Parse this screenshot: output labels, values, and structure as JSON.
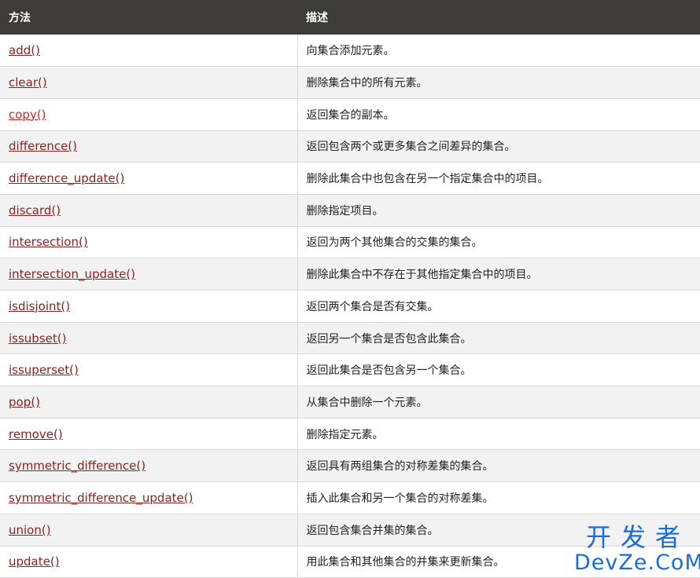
{
  "table": {
    "headers": [
      "方法",
      "描述"
    ],
    "rows": [
      {
        "method": "add()",
        "description": "向集合添加元素。"
      },
      {
        "method": "clear()",
        "description": "删除集合中的所有元素。"
      },
      {
        "method": "copy()",
        "description": "返回集合的副本。"
      },
      {
        "method": "difference()",
        "description": "返回包含两个或更多集合之间差异的集合。"
      },
      {
        "method": "difference_update()",
        "description": "删除此集合中也包含在另一个指定集合中的项目。"
      },
      {
        "method": "discard()",
        "description": "删除指定项目。"
      },
      {
        "method": "intersection()",
        "description": "返回为两个其他集合的交集的集合。"
      },
      {
        "method": "intersection_update()",
        "description": "删除此集合中不存在于其他指定集合中的项目。"
      },
      {
        "method": "isdisjoint()",
        "description": "返回两个集合是否有交集。"
      },
      {
        "method": "issubset()",
        "description": "返回另一个集合是否包含此集合。"
      },
      {
        "method": "issuperset()",
        "description": "返回此集合是否包含另一个集合。"
      },
      {
        "method": "pop()",
        "description": "从集合中删除一个元素。"
      },
      {
        "method": "remove()",
        "description": "删除指定元素。"
      },
      {
        "method": "symmetric_difference()",
        "description": "返回具有两组集合的对称差集的集合。"
      },
      {
        "method": "symmetric_difference_update()",
        "description": "插入此集合和另一个集合的对称差集。"
      },
      {
        "method": "union()",
        "description": "返回包含集合并集的集合。"
      },
      {
        "method": "update()",
        "description": "用此集合和其他集合的并集来更新集合。"
      }
    ]
  },
  "watermark": {
    "chinese": "开发者",
    "english": "DevZe.CoM"
  },
  "colors": {
    "header_bg": "#3d3c38",
    "link": "#8b1f1f",
    "visited_link": "#e02020",
    "row_alt": "#f2f2f2",
    "watermark": "#1a6dd6"
  }
}
